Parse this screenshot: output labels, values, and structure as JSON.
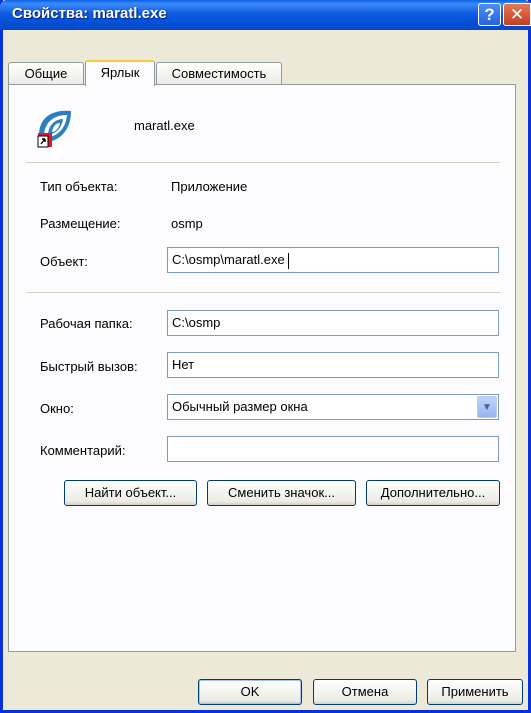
{
  "window": {
    "title": "Свойства: maratl.exe"
  },
  "tabs": [
    {
      "label": "Общие"
    },
    {
      "label": "Ярлык"
    },
    {
      "label": "Совместимость"
    }
  ],
  "file": {
    "name": "maratl.exe",
    "icon": "app-shortcut-icon"
  },
  "info": {
    "type_label": "Тип объекта:",
    "type_value": "Приложение",
    "location_label": "Размещение:",
    "location_value": "osmp"
  },
  "target": {
    "label": "Объект:",
    "value": "C:\\osmp\\maratl.exe"
  },
  "start_in": {
    "label": "Рабочая папка:",
    "value": "C:\\osmp"
  },
  "shortcut_key": {
    "label": "Быстрый вызов:",
    "value": "Нет"
  },
  "run": {
    "label": "Окно:",
    "value": "Обычный размер окна"
  },
  "comment": {
    "label": "Комментарий:",
    "value": ""
  },
  "actions": {
    "find_target": "Найти объект...",
    "change_icon": "Сменить значок...",
    "advanced": "Дополнительно..."
  },
  "footer": {
    "ok": "OK",
    "cancel": "Отмена",
    "apply": "Применить"
  },
  "colors": {
    "titlebar": "#0A5FE8",
    "window_bg": "#ECE9D8",
    "panel_bg": "#FCFCFE",
    "focus_tab": "#FFC83C"
  }
}
